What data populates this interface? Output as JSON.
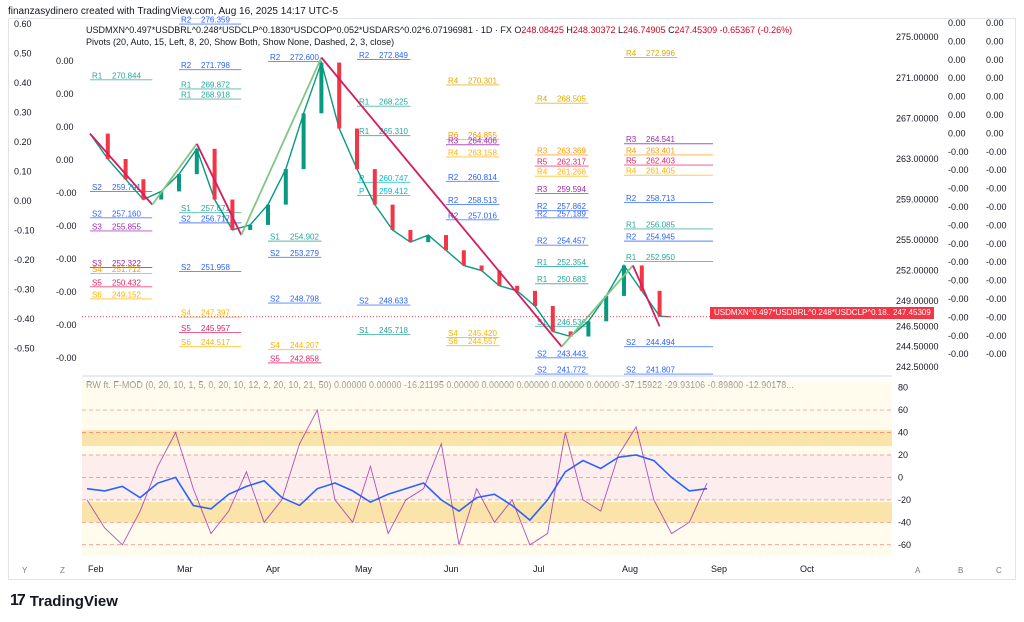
{
  "attribution": "finanzasydinero created with TradingView.com, Aug 16, 2025 14:17 UTC-5",
  "chart_data": [
    {
      "type": "line",
      "pane": "price",
      "symbol": "USDMXN^0.497*USDBRL^0.248*USDCLP^0.1830*USDCOP^0.052*USDARS^0.02*6.07196981 · 1D · FX",
      "ohlc": {
        "o_label": "O",
        "o": "248.08425",
        "h_label": "H",
        "h": "248.30372",
        "l_label": "L",
        "l": "246.74905",
        "c_label": "C",
        "c": "247.45309",
        "change": "-0.65367 (-0.26%)"
      },
      "pivots_label": "Pivots (20, Auto, 15, Left, 8, 20, Show Both, Show None, Dashed, 2, 3, close)",
      "x_ticks": [
        "Feb",
        "Mar",
        "Apr",
        "May",
        "Jun",
        "Jul",
        "Aug",
        "Sep",
        "Oct"
      ],
      "y_ticks": [
        "275.00000",
        "271.00000",
        "267.00000",
        "263.00000",
        "259.00000",
        "255.00000",
        "252.00000",
        "249.00000",
        "246.50000",
        "244.50000",
        "242.50000"
      ],
      "ylim": [
        242.0,
        276.5
      ],
      "last_price": "247.45309",
      "last_price_label": "USDMXN^0.497*USDBRL^0.248*USDCLP^0.18...",
      "left_scale_ticks": [
        "0.60",
        "0.50",
        "0.40",
        "0.30",
        "0.20",
        "0.10",
        "0.00",
        "-0.10",
        "-0.20",
        "-0.30",
        "-0.40",
        "-0.50"
      ],
      "left_inner_ticks": [
        "0.00",
        "0.00",
        "0.00",
        "0.00",
        "-0.00",
        "-0.00",
        "-0.00",
        "-0.00",
        "-0.00",
        "-0.00"
      ],
      "right_scale_a": [
        "0.00",
        "0.00",
        "0.00",
        "0.00",
        "0.00",
        "0.00",
        "0.00",
        "-0.00",
        "-0.00",
        "-0.00",
        "-0.00",
        "-0.00",
        "-0.00",
        "-0.00",
        "-0.00",
        "-0.00",
        "-0.00",
        "-0.00",
        "-0.00"
      ],
      "right_scale_b": [
        "0.00",
        "0.00",
        "0.00",
        "0.00",
        "0.00",
        "0.00",
        "0.00",
        "-0.00",
        "-0.00",
        "-0.00",
        "-0.00",
        "-0.00",
        "-0.00",
        "-0.00",
        "-0.00",
        "-0.00",
        "-0.00",
        "-0.00",
        "-0.00"
      ],
      "closes": [
        {
          "m": 0.0,
          "c": 265.5
        },
        {
          "m": 0.2,
          "c": 263.0
        },
        {
          "m": 0.4,
          "c": 261.0
        },
        {
          "m": 0.6,
          "c": 259.0
        },
        {
          "m": 0.8,
          "c": 259.8
        },
        {
          "m": 1.0,
          "c": 261.5
        },
        {
          "m": 1.2,
          "c": 264.0
        },
        {
          "m": 1.4,
          "c": 259.0
        },
        {
          "m": 1.6,
          "c": 256.0
        },
        {
          "m": 1.8,
          "c": 256.5
        },
        {
          "m": 2.0,
          "c": 258.5
        },
        {
          "m": 2.2,
          "c": 262.0
        },
        {
          "m": 2.4,
          "c": 267.5
        },
        {
          "m": 2.6,
          "c": 272.5
        },
        {
          "m": 2.8,
          "c": 266.0
        },
        {
          "m": 3.0,
          "c": 262.0
        },
        {
          "m": 3.2,
          "c": 258.5
        },
        {
          "m": 3.4,
          "c": 256.0
        },
        {
          "m": 3.6,
          "c": 254.8
        },
        {
          "m": 3.8,
          "c": 255.5
        },
        {
          "m": 4.0,
          "c": 254.0
        },
        {
          "m": 4.2,
          "c": 252.5
        },
        {
          "m": 4.4,
          "c": 252.0
        },
        {
          "m": 4.6,
          "c": 250.5
        },
        {
          "m": 4.8,
          "c": 250.0
        },
        {
          "m": 5.0,
          "c": 248.5
        },
        {
          "m": 5.2,
          "c": 246.0
        },
        {
          "m": 5.4,
          "c": 245.5
        },
        {
          "m": 5.6,
          "c": 247.0
        },
        {
          "m": 5.8,
          "c": 249.5
        },
        {
          "m": 6.0,
          "c": 252.5
        },
        {
          "m": 6.2,
          "c": 250.0
        },
        {
          "m": 6.4,
          "c": 247.5
        },
        {
          "m": 6.5,
          "c": 247.45
        }
      ],
      "zigzag": [
        {
          "m": 0.0,
          "v": 265.5
        },
        {
          "m": 0.7,
          "v": 258.5
        },
        {
          "m": 1.2,
          "v": 264.5
        },
        {
          "m": 1.7,
          "v": 255.5
        },
        {
          "m": 2.6,
          "v": 273.0
        },
        {
          "m": 5.3,
          "v": 244.5
        },
        {
          "m": 6.1,
          "v": 252.5
        },
        {
          "m": 6.4,
          "v": 246.5
        }
      ],
      "pivot_levels": [
        {
          "label": "R2",
          "value": "276.359",
          "m0": 1.0,
          "m1": 1.7,
          "v": 276.3,
          "color": "#2962ff"
        },
        {
          "label": "R1",
          "value": "270.844",
          "m0": 0.0,
          "m1": 0.7,
          "v": 270.8,
          "color": "#26a69a"
        },
        {
          "label": "R2",
          "value": "271.798",
          "m0": 1.0,
          "m1": 1.7,
          "v": 271.8,
          "color": "#2962ff"
        },
        {
          "label": "R1",
          "value": "269.872",
          "m0": 1.0,
          "m1": 1.7,
          "v": 269.9,
          "color": "#26a69a"
        },
        {
          "label": "R1",
          "value": "268.918",
          "m0": 1.0,
          "m1": 1.7,
          "v": 268.9,
          "color": "#26a69a"
        },
        {
          "label": "R2",
          "value": "272.600",
          "m0": 2.0,
          "m1": 2.6,
          "v": 272.6,
          "color": "#2962ff"
        },
        {
          "label": "R2",
          "value": "272.849",
          "m0": 3.0,
          "m1": 3.6,
          "v": 272.8,
          "color": "#2962ff"
        },
        {
          "label": "R1",
          "value": "268.225",
          "m0": 3.0,
          "m1": 3.6,
          "v": 268.2,
          "color": "#26a69a"
        },
        {
          "label": "R1",
          "value": "265.310",
          "m0": 3.0,
          "m1": 3.6,
          "v": 265.3,
          "color": "#26a69a"
        },
        {
          "label": "R4",
          "value": "270.301",
          "m0": 4.0,
          "m1": 4.6,
          "v": 270.3,
          "color": "#e0a800"
        },
        {
          "label": "R4",
          "value": "268.505",
          "m0": 5.0,
          "m1": 5.6,
          "v": 268.5,
          "color": "#e0a800"
        },
        {
          "label": "R4",
          "value": "272.996",
          "m0": 6.0,
          "m1": 6.6,
          "v": 273.0,
          "color": "#e0a800"
        },
        {
          "label": "R3",
          "value": "264.541",
          "m0": 6.0,
          "m1": 7.0,
          "v": 264.5,
          "color": "#9c27b0"
        },
        {
          "label": "R4",
          "value": "263.401",
          "m0": 6.0,
          "m1": 7.0,
          "v": 263.4,
          "color": "#ff9800"
        },
        {
          "label": "R5",
          "value": "262.403",
          "m0": 6.0,
          "m1": 7.0,
          "v": 262.4,
          "color": "#e91e63"
        },
        {
          "label": "R4",
          "value": "261.405",
          "m0": 6.0,
          "m1": 7.0,
          "v": 261.4,
          "color": "#ffb300"
        },
        {
          "label": "R3",
          "value": "263.369",
          "m0": 5.0,
          "m1": 5.6,
          "v": 263.4,
          "color": "#ff9800"
        },
        {
          "label": "R5",
          "value": "262.317",
          "m0": 5.0,
          "m1": 5.6,
          "v": 262.3,
          "color": "#e91e63"
        },
        {
          "label": "R4",
          "value": "261.266",
          "m0": 5.0,
          "m1": 5.6,
          "v": 261.3,
          "color": "#ffb300"
        },
        {
          "label": "R3",
          "value": "259.594",
          "m0": 5.0,
          "m1": 5.6,
          "v": 259.6,
          "color": "#9c27b0"
        },
        {
          "label": "R2",
          "value": "258.713",
          "m0": 6.0,
          "m1": 7.0,
          "v": 258.7,
          "color": "#2962ff"
        },
        {
          "label": "R2",
          "value": "257.862",
          "m0": 5.0,
          "m1": 5.6,
          "v": 257.9,
          "color": "#2962ff"
        },
        {
          "label": "R2",
          "value": "257.189",
          "m0": 5.0,
          "m1": 5.6,
          "v": 257.2,
          "color": "#2962ff"
        },
        {
          "label": "R1",
          "value": "256.085",
          "m0": 6.0,
          "m1": 7.0,
          "v": 256.1,
          "color": "#26a69a"
        },
        {
          "label": "R2",
          "value": "254.945",
          "m0": 6.0,
          "m1": 7.0,
          "v": 254.9,
          "color": "#2962ff"
        },
        {
          "label": "R2",
          "value": "254.457",
          "m0": 5.0,
          "m1": 5.6,
          "v": 254.5,
          "color": "#2962ff"
        },
        {
          "label": "R1",
          "value": "252.950",
          "m0": 6.0,
          "m1": 7.0,
          "v": 252.9,
          "color": "#26a69a"
        },
        {
          "label": "R1",
          "value": "252.354",
          "m0": 5.0,
          "m1": 5.6,
          "v": 252.4,
          "color": "#26a69a"
        },
        {
          "label": "R1",
          "value": "250.683",
          "m0": 5.0,
          "m1": 5.6,
          "v": 250.7,
          "color": "#26a69a"
        },
        {
          "label": "R6",
          "value": "264.855",
          "m0": 4.0,
          "m1": 4.6,
          "v": 264.9,
          "color": "#ff9800"
        },
        {
          "label": "R3",
          "value": "264.406",
          "m0": 4.0,
          "m1": 4.6,
          "v": 264.4,
          "color": "#9c27b0"
        },
        {
          "label": "R4",
          "value": "263.158",
          "m0": 4.0,
          "m1": 4.6,
          "v": 263.2,
          "color": "#ffb300"
        },
        {
          "label": "R2",
          "value": "260.814",
          "m0": 4.0,
          "m1": 4.6,
          "v": 260.8,
          "color": "#2962ff"
        },
        {
          "label": "P",
          "value": "260.747",
          "m0": 3.0,
          "m1": 3.6,
          "v": 260.7,
          "color": "#00bcd4"
        },
        {
          "label": "P",
          "value": "259.412",
          "m0": 3.0,
          "m1": 3.6,
          "v": 259.4,
          "color": "#00bcd4"
        },
        {
          "label": "R2",
          "value": "258.513",
          "m0": 4.0,
          "m1": 4.6,
          "v": 258.5,
          "color": "#2962ff"
        },
        {
          "label": "R2",
          "value": "257.016",
          "m0": 4.0,
          "m1": 4.6,
          "v": 257.0,
          "color": "#2962ff"
        },
        {
          "label": "S2",
          "value": "259.791",
          "m0": 0.0,
          "m1": 0.7,
          "v": 259.8,
          "color": "#2962ff"
        },
        {
          "label": "S2",
          "value": "257.160",
          "m0": 0.0,
          "m1": 0.7,
          "v": 257.2,
          "color": "#2962ff"
        },
        {
          "label": "S3",
          "value": "255.855",
          "m0": 0.0,
          "m1": 0.7,
          "v": 255.9,
          "color": "#9c27b0"
        },
        {
          "label": "S1",
          "value": "257.671",
          "m0": 1.0,
          "m1": 1.7,
          "v": 257.7,
          "color": "#26a69a"
        },
        {
          "label": "S2",
          "value": "256.717",
          "m0": 1.0,
          "m1": 1.7,
          "v": 256.7,
          "color": "#2962ff"
        },
        {
          "label": "S1",
          "value": "254.902",
          "m0": 2.0,
          "m1": 2.6,
          "v": 254.9,
          "color": "#26a69a"
        },
        {
          "label": "S2",
          "value": "253.279",
          "m0": 2.0,
          "m1": 2.6,
          "v": 253.3,
          "color": "#2962ff"
        },
        {
          "label": "S3",
          "value": "252.322",
          "m0": 0.0,
          "m1": 0.7,
          "v": 252.3,
          "color": "#9c27b0"
        },
        {
          "label": "S4",
          "value": "251.712",
          "m0": 0.0,
          "m1": 0.7,
          "v": 251.7,
          "color": "#ff9800"
        },
        {
          "label": "S5",
          "value": "250.432",
          "m0": 0.0,
          "m1": 0.7,
          "v": 250.4,
          "color": "#e91e63"
        },
        {
          "label": "S6",
          "value": "249.152",
          "m0": 0.0,
          "m1": 0.7,
          "v": 249.2,
          "color": "#ffb300"
        },
        {
          "label": "S2",
          "value": "251.958",
          "m0": 1.0,
          "m1": 1.7,
          "v": 251.9,
          "color": "#2962ff"
        },
        {
          "label": "S2",
          "value": "248.798",
          "m0": 2.0,
          "m1": 2.6,
          "v": 248.8,
          "color": "#2962ff"
        },
        {
          "label": "S2",
          "value": "248.633",
          "m0": 3.0,
          "m1": 3.6,
          "v": 248.6,
          "color": "#2962ff"
        },
        {
          "label": "S4",
          "value": "247.397",
          "m0": 1.0,
          "m1": 1.7,
          "v": 247.4,
          "color": "#ffb300"
        },
        {
          "label": "S5",
          "value": "245.957",
          "m0": 1.0,
          "m1": 1.7,
          "v": 245.9,
          "color": "#e91e63"
        },
        {
          "label": "S6",
          "value": "244.517",
          "m0": 1.0,
          "m1": 1.7,
          "v": 244.5,
          "color": "#ffb300"
        },
        {
          "label": "S1",
          "value": "245.718",
          "m0": 3.0,
          "m1": 3.6,
          "v": 245.7,
          "color": "#26a69a"
        },
        {
          "label": "S4",
          "value": "245.420",
          "m0": 4.0,
          "m1": 4.6,
          "v": 245.4,
          "color": "#ffb300"
        },
        {
          "label": "S4",
          "value": "244.207",
          "m0": 2.0,
          "m1": 2.6,
          "v": 244.2,
          "color": "#ffb300"
        },
        {
          "label": "S6",
          "value": "244.557",
          "m0": 4.0,
          "m1": 4.6,
          "v": 244.6,
          "color": "#ffb300"
        },
        {
          "label": "S5",
          "value": "242.858",
          "m0": 2.0,
          "m1": 2.6,
          "v": 242.9,
          "color": "#e91e63"
        },
        {
          "label": "S2",
          "value": "243.443",
          "m0": 5.0,
          "m1": 5.6,
          "v": 243.4,
          "color": "#2962ff"
        },
        {
          "label": "S2",
          "value": "244.494",
          "m0": 6.0,
          "m1": 7.0,
          "v": 244.5,
          "color": "#2962ff"
        },
        {
          "label": "S1",
          "value": "246.536",
          "m0": 5.0,
          "m1": 5.6,
          "v": 246.5,
          "color": "#26a69a"
        },
        {
          "label": "S2",
          "value": "241.772",
          "m0": 5.0,
          "m1": 5.6,
          "v": 241.8,
          "color": "#2962ff"
        },
        {
          "label": "S2",
          "value": "241.807",
          "m0": 6.0,
          "m1": 7.0,
          "v": 241.8,
          "color": "#2962ff"
        }
      ]
    },
    {
      "type": "line",
      "pane": "oscillator",
      "indicator_label": "RW ft. F-MOD (0, 20, 10, 1, 5, 0, 20, 10, 12, 2, 20, 10, 21, 50)",
      "indicator_values": [
        "0.00000",
        "0.00000",
        "-16.21195",
        "0.00000",
        "0.00000",
        "0.00000",
        "0.00000",
        "0.00000",
        "-37.15922",
        "-29.93106",
        "-0.89800",
        "-12.90178..."
      ],
      "y_ticks": [
        "80",
        "60",
        "40",
        "20",
        "0",
        "-20",
        "-40",
        "-60"
      ],
      "ylim": [
        -70,
        85
      ],
      "bands": {
        "upper": [
          28,
          42
        ],
        "lower": [
          -40,
          -22
        ]
      },
      "series": [
        {
          "name": "",
          "color": "#2962ff",
          "values": [
            -10,
            -12,
            -8,
            -18,
            -5,
            0,
            -25,
            -28,
            -15,
            -8,
            -3,
            -18,
            -25,
            -10,
            -5,
            -12,
            -22,
            -15,
            -10,
            -5,
            -20,
            -30,
            -18,
            -15,
            -25,
            -38,
            -20,
            5,
            15,
            8,
            18,
            20,
            15,
            0,
            -12,
            -10
          ]
        },
        {
          "name": "",
          "color": "#9c27b0",
          "values": [
            -20,
            -45,
            -60,
            -30,
            10,
            40,
            -10,
            -50,
            -30,
            5,
            -40,
            -20,
            30,
            60,
            -20,
            -40,
            10,
            -50,
            -20,
            -10,
            30,
            -60,
            -10,
            -40,
            -20,
            -60,
            -50,
            40,
            -20,
            -30,
            20,
            45,
            -20,
            -50,
            -40,
            -5
          ]
        }
      ]
    }
  ],
  "brand": "TradingView",
  "bottom_letters": [
    "Y",
    "Z",
    "A",
    "B",
    "C"
  ]
}
